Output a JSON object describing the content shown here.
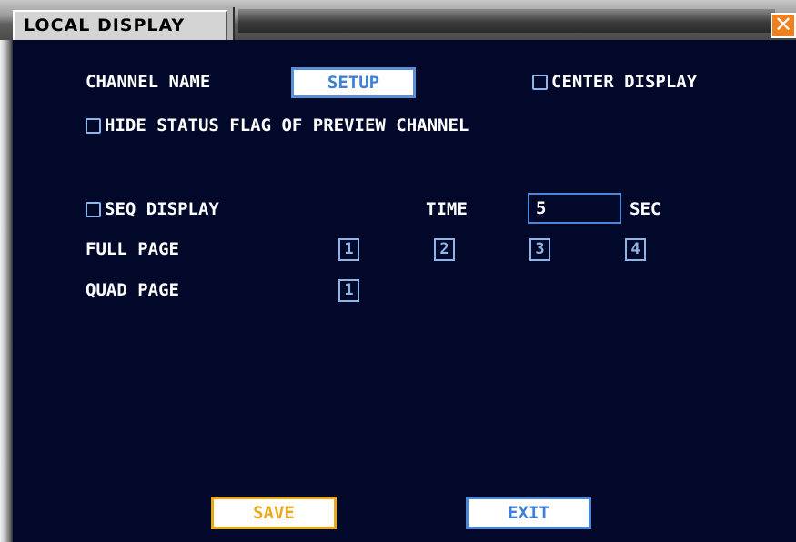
{
  "window": {
    "title": "LOCAL DISPLAY",
    "close_symbol": "✕"
  },
  "channel_name": {
    "label": "CHANNEL NAME",
    "setup_button": "SETUP"
  },
  "center_display": {
    "label": "CENTER DISPLAY",
    "checked": false
  },
  "hide_status_flag": {
    "label": "HIDE STATUS FLAG OF PREVIEW CHANNEL",
    "checked": false
  },
  "seq_display": {
    "label": "SEQ DISPLAY",
    "checked": false
  },
  "time": {
    "label": "TIME",
    "value": "5",
    "unit": "SEC"
  },
  "full_page": {
    "label": "FULL PAGE",
    "pages": [
      "1",
      "2",
      "3",
      "4"
    ]
  },
  "quad_page": {
    "label": "QUAD PAGE",
    "pages": [
      "1"
    ]
  },
  "footer": {
    "save": "SAVE",
    "exit": "EXIT"
  },
  "colors": {
    "panel_bg": "#020829",
    "accent_blue": "#4c86d6",
    "save_orange": "#e9a91f",
    "close_orange": "#f07f1e"
  }
}
